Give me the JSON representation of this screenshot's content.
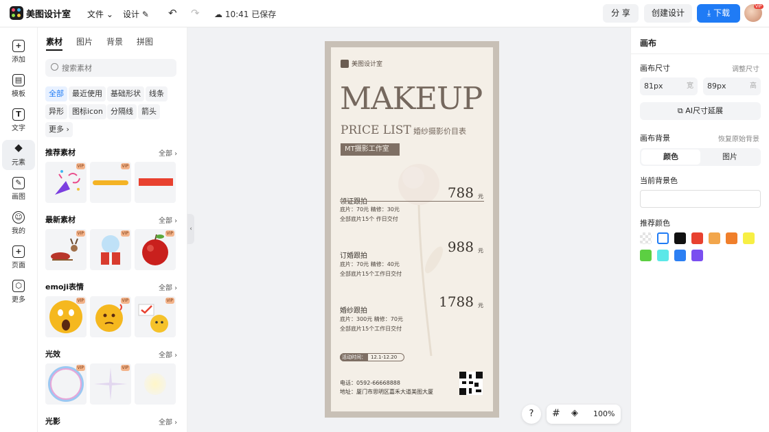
{
  "app": {
    "name": "美图设计室"
  },
  "topbar": {
    "file_label": "文件",
    "design_label": "设计",
    "saved_status": "10:41 已保存",
    "share_label": "分 享",
    "create_label": "创建设计",
    "download_label": "下载",
    "avatar_badge": "VIP"
  },
  "rail": {
    "items": [
      {
        "label": "添加",
        "icon": "plus-square-icon"
      },
      {
        "label": "模板",
        "icon": "template-icon"
      },
      {
        "label": "文字",
        "icon": "text-icon"
      },
      {
        "label": "元素",
        "icon": "shapes-icon"
      },
      {
        "label": "画图",
        "icon": "draw-icon"
      },
      {
        "label": "我的",
        "icon": "user-icon"
      },
      {
        "label": "页面",
        "icon": "page-add-icon"
      },
      {
        "label": "更多",
        "icon": "cube-icon"
      }
    ]
  },
  "materials": {
    "tabs": [
      "素材",
      "图片",
      "背景",
      "拼图"
    ],
    "search_placeholder": "搜索素材",
    "chips": [
      "全部",
      "最近使用",
      "基础形状",
      "线条",
      "异形",
      "图标icon",
      "分隔线",
      "箭头",
      "更多"
    ],
    "all_label": "全部",
    "vip_label": "VIP",
    "sections": [
      {
        "title": "推荐素材"
      },
      {
        "title": "最新素材"
      },
      {
        "title": "emoji表情"
      },
      {
        "title": "光效"
      },
      {
        "title": "光影"
      }
    ]
  },
  "poster": {
    "brand": "美图设计室",
    "headline": "MAKEUP",
    "price_list": "PRICE LIST",
    "subtitle": "婚纱摄影价目表",
    "studio": "MT摄影工作室",
    "unit": "元",
    "packages": [
      {
        "name": "领证跟拍",
        "price": "788",
        "line1": "底片：70元  精修：30元",
        "line2": "全部底片15个  作日交付"
      },
      {
        "name": "订婚跟拍",
        "price": "988",
        "line1": "底片：70元  精修：40元",
        "line2": "全部底片15个工作日交付"
      },
      {
        "name": "婚纱跟拍",
        "price": "1788",
        "line1": "底片：300元  精修：70元",
        "line2": "全部底片15个工作日交付"
      }
    ],
    "event_label": "活动时间：",
    "event_value": "12.1-12.20",
    "phone": "电话：0592-66668888",
    "address": "地址：厦门市思明区嘉禾大道美图大厦"
  },
  "canvas_controls": {
    "help": "?",
    "zoom": "100%"
  },
  "right_panel": {
    "title": "画布",
    "size_label": "画布尺寸",
    "resize_link": "调整尺寸",
    "width_value": "81px",
    "width_unit": "宽",
    "height_value": "89px",
    "height_unit": "高",
    "ai_extend_label": "AI尺寸延展",
    "bg_label": "画布背景",
    "restore_link": "恢复原始背景",
    "seg_color": "颜色",
    "seg_image": "图片",
    "current_bg_label": "当前背景色",
    "recommend_label": "推荐颜色",
    "swatches": [
      "transparent",
      "#ffffff",
      "#111111",
      "#e8412f",
      "#f2a64c",
      "#f07f2b",
      "#f7ef44",
      "#5ccf42",
      "#5ce8e8",
      "#2c7ff3",
      "#7a4ff0"
    ]
  },
  "colors": {
    "accent": "#1f7bf5",
    "poster_bg": "#f4efe7",
    "poster_frame": "#c8c0b6"
  }
}
